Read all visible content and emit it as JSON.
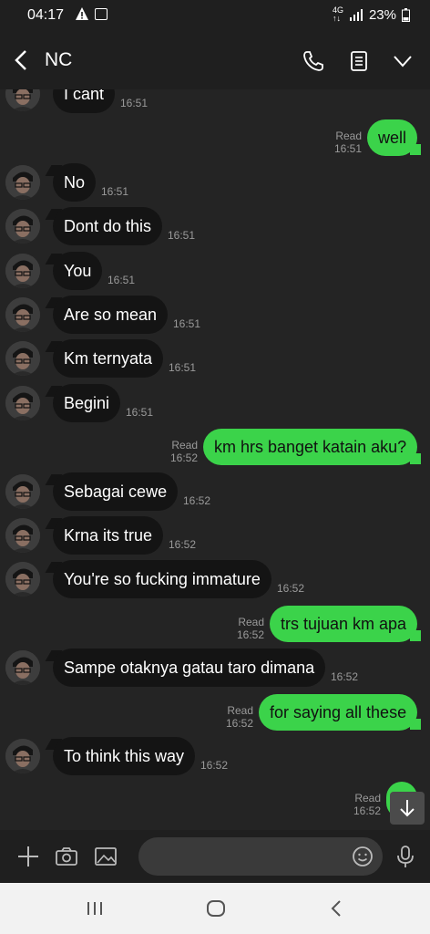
{
  "status_bar": {
    "time": "04:17",
    "battery": "23%"
  },
  "header": {
    "contact_name": "NC"
  },
  "messages": [
    {
      "side": "in",
      "text": "I cant",
      "time": "16:51"
    },
    {
      "side": "out",
      "text": "well",
      "read": "Read",
      "time": "16:51"
    },
    {
      "side": "in",
      "text": "No",
      "time": "16:51"
    },
    {
      "side": "in",
      "text": "Dont do this",
      "time": "16:51"
    },
    {
      "side": "in",
      "text": "You",
      "time": "16:51"
    },
    {
      "side": "in",
      "text": "Are so mean",
      "time": "16:51"
    },
    {
      "side": "in",
      "text": "Km ternyata",
      "time": "16:51"
    },
    {
      "side": "in",
      "text": "Begini",
      "time": "16:51"
    },
    {
      "side": "out",
      "text": "km hrs banget katain aku?",
      "read": "Read",
      "time": "16:52"
    },
    {
      "side": "in",
      "text": "Sebagai cewe",
      "time": "16:52"
    },
    {
      "side": "in",
      "text": "Krna its true",
      "time": "16:52"
    },
    {
      "side": "in",
      "text": "You're so fucking immature",
      "time": "16:52"
    },
    {
      "side": "out",
      "text": "trs tujuan km apa",
      "read": "Read",
      "time": "16:52"
    },
    {
      "side": "in",
      "text": "Sampe otaknya gatau taro dimana",
      "time": "16:52"
    },
    {
      "side": "out",
      "text": "for saying all these",
      "read": "Read",
      "time": "16:52"
    },
    {
      "side": "in",
      "text": "To think this way",
      "time": "16:52"
    },
    {
      "side": "out",
      "text": "",
      "read": "Read",
      "time": "16:52"
    }
  ],
  "composer": {
    "placeholder": ""
  },
  "colors": {
    "outgoing_bubble": "#3bd34a",
    "incoming_bubble": "#141414",
    "background": "#242424"
  }
}
